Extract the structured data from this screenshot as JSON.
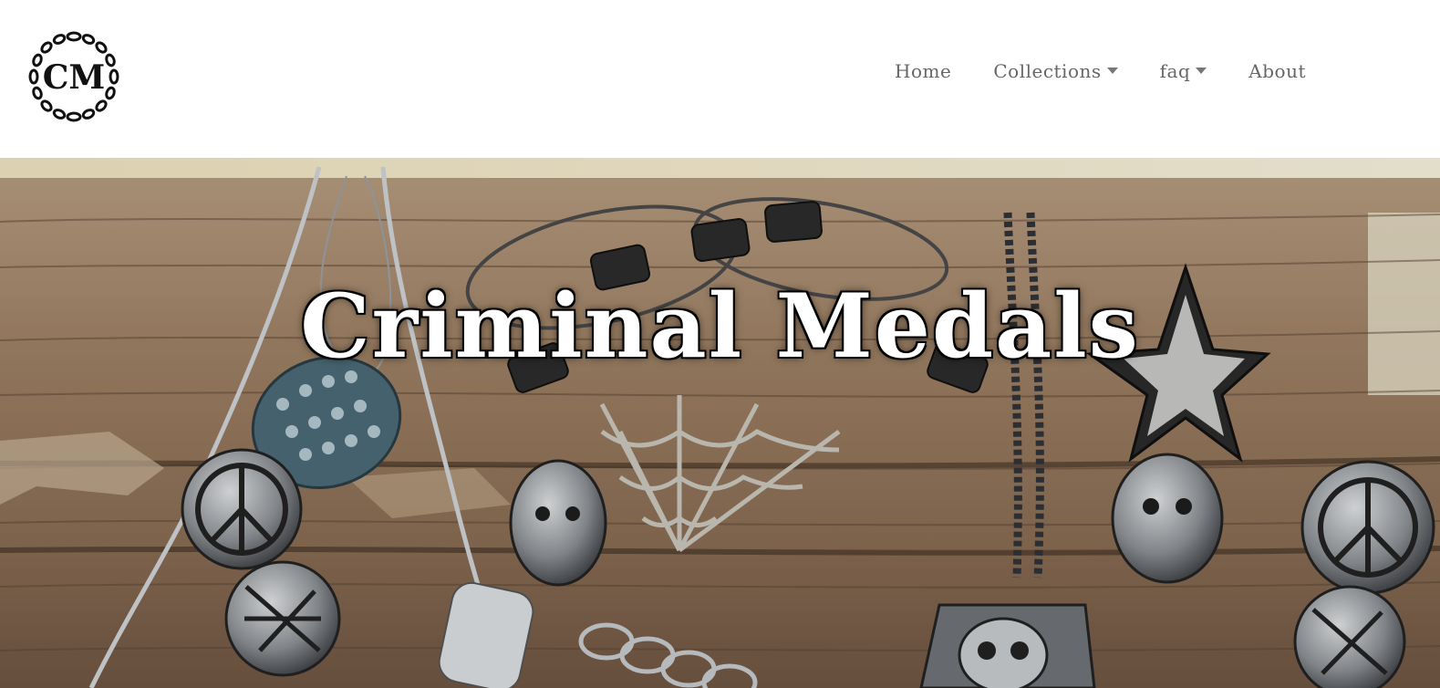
{
  "brand": {
    "logo_text": "CM",
    "logo_icon": "chain-ring-monogram-icon"
  },
  "nav": {
    "items": [
      {
        "label": "Home",
        "has_dropdown": false
      },
      {
        "label": "Collections",
        "has_dropdown": true
      },
      {
        "label": "faq",
        "has_dropdown": true
      },
      {
        "label": "About",
        "has_dropdown": false
      }
    ]
  },
  "hero": {
    "title": "Criminal Medals"
  },
  "colors": {
    "nav_text": "#666666",
    "hero_title": "#ffffff",
    "wood_light": "#a08366",
    "wood_dark": "#5a4232",
    "metal": "#b8bcc0"
  }
}
